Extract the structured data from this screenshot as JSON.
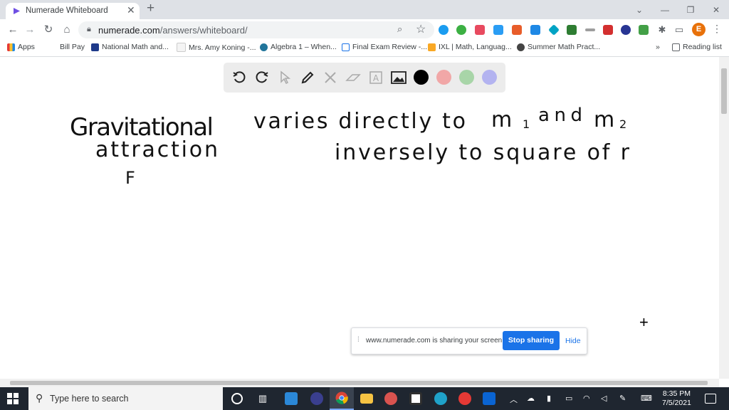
{
  "browser": {
    "tab_title": "Numerade Whiteboard",
    "url_domain": "numerade.com",
    "url_path": "/answers/whiteboard/",
    "profile_initial": "E",
    "bookmarks": [
      {
        "label": "Apps",
        "icon": "apps-grid-icon"
      },
      {
        "label": "Bill Pay",
        "icon": "bill-pay-icon"
      },
      {
        "label": "National Math and...",
        "icon": "national-math-icon"
      },
      {
        "label": "Mrs. Amy Koning -...",
        "icon": "google-sites-icon"
      },
      {
        "label": "Algebra 1 – When...",
        "icon": "wordpress-icon"
      },
      {
        "label": "Final Exam Review -...",
        "icon": "calendar-icon"
      },
      {
        "label": "IXL | Math, Languag...",
        "icon": "ixl-icon"
      },
      {
        "label": "Summer Math Pract...",
        "icon": "summer-math-icon"
      }
    ],
    "bookmarks_overflow": "»",
    "reading_list": "Reading list"
  },
  "whiteboard": {
    "tools": [
      "undo-icon",
      "redo-icon",
      "pointer-icon",
      "pen-icon",
      "tools-icon",
      "eraser-icon",
      "text-icon",
      "image-icon"
    ],
    "colors": [
      "#000000",
      "#f1a7a7",
      "#a8d5a8",
      "#b3b3f0"
    ],
    "handwriting": {
      "word1": "Gravitational",
      "word2": "attraction",
      "symbol": "F",
      "line1": "varies directly to",
      "m1": "m",
      "m1_sub": "1",
      "and": "and",
      "m2": "m",
      "m2_sub": "2",
      "line2": "inversely to square of r"
    }
  },
  "share_banner": {
    "message": "www.numerade.com is sharing your screen.",
    "stop_label": "Stop sharing",
    "hide_label": "Hide"
  },
  "taskbar": {
    "search_placeholder": "Type here to search",
    "time": "8:35 PM",
    "date": "7/5/2021"
  }
}
